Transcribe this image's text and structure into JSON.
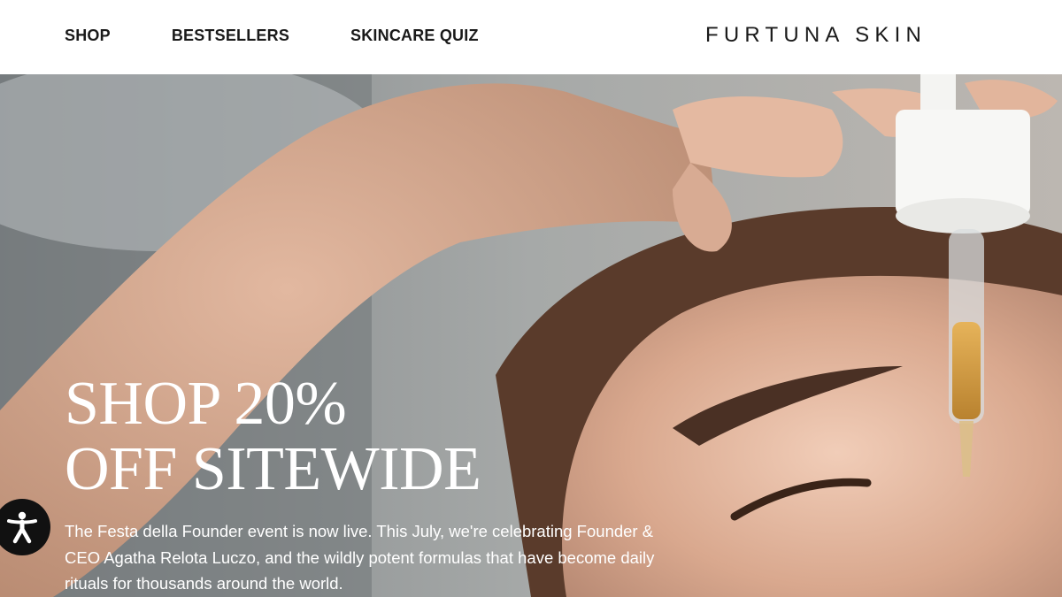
{
  "header": {
    "nav": [
      {
        "label": "SHOP"
      },
      {
        "label": "BESTSELLERS"
      },
      {
        "label": "SKINCARE QUIZ"
      }
    ],
    "logo": "FURTUNA SKIN"
  },
  "hero": {
    "title_line1": "SHOP 20%",
    "title_line2": "OFF SITEWIDE",
    "text": "The Festa della Founder event is now live. This July, we're celebrating Founder & CEO Agatha Relota Luczo, and the wildly potent formulas that have become daily rituals for thousands around the world.",
    "image_icon": "dropper-serum-photo"
  },
  "accessibility": {
    "icon": "accessibility-icon"
  },
  "colors": {
    "text_dark": "#1a1a1a",
    "header_bg": "#ffffff",
    "hero_text": "#ffffff",
    "a11y_bg": "#111111"
  }
}
